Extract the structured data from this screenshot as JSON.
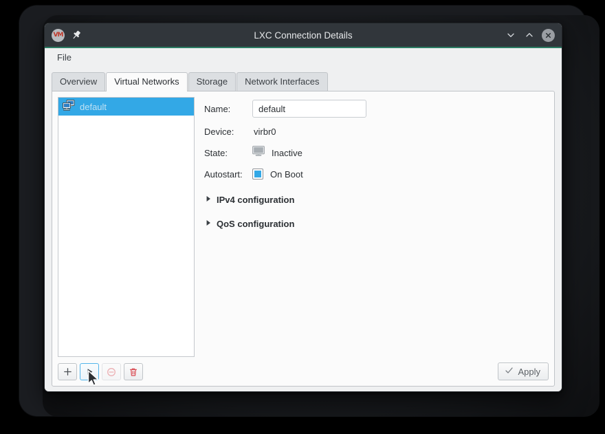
{
  "window": {
    "title": "LXC Connection Details",
    "app_icon": "vm-icon",
    "app_icon_text": "VM",
    "pin_icon": "pin-icon",
    "controls": {
      "minimize": "chevron-down-icon",
      "maximize": "chevron-up-icon",
      "close": "close-icon"
    },
    "accent_color": "#2b7d63"
  },
  "menubar": {
    "items": [
      {
        "label": "File"
      }
    ]
  },
  "tabs": [
    {
      "label": "Overview",
      "active": false
    },
    {
      "label": "Virtual Networks",
      "active": true
    },
    {
      "label": "Storage",
      "active": false
    },
    {
      "label": "Network Interfaces",
      "active": false
    }
  ],
  "network_list": {
    "items": [
      {
        "label": "default",
        "icon": "network-computers-icon",
        "selected": true
      }
    ],
    "selection_color": "#33a8e6"
  },
  "list_toolbar": {
    "buttons": [
      {
        "name": "add-network-button",
        "icon": "plus-icon",
        "state": "enabled"
      },
      {
        "name": "start-network-button",
        "icon": "play-icon",
        "state": "hover"
      },
      {
        "name": "stop-network-button",
        "icon": "stop-circle-icon",
        "state": "disabled"
      },
      {
        "name": "delete-network-button",
        "icon": "trash-icon",
        "state": "enabled"
      }
    ]
  },
  "details": {
    "name": {
      "label": "Name:",
      "value": "default",
      "placeholder": ""
    },
    "device": {
      "label": "Device:",
      "value": "virbr0"
    },
    "state": {
      "label": "State:",
      "value": "Inactive",
      "icon": "monitor-inactive-icon"
    },
    "autostart": {
      "label": "Autostart:",
      "value": "On Boot",
      "checked": true
    },
    "expanders": [
      {
        "label": "IPv4 configuration",
        "expanded": false,
        "icon": "triangle-right-icon"
      },
      {
        "label": "QoS configuration",
        "expanded": false,
        "icon": "triangle-right-icon"
      }
    ]
  },
  "apply": {
    "label": "Apply",
    "icon": "check-icon",
    "enabled": false
  }
}
